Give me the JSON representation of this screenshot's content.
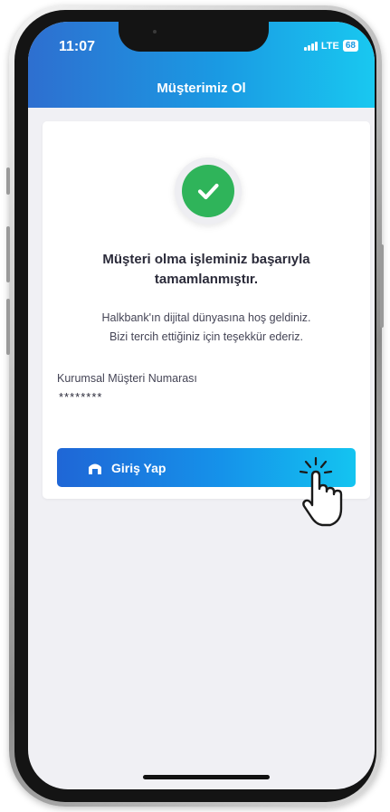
{
  "status_bar": {
    "time": "11:07",
    "network": "LTE",
    "battery": "68"
  },
  "header": {
    "title": "Müşterimiz Ol"
  },
  "success": {
    "title_line1": "Müşteri olma işleminiz başarıyla",
    "title_line2": "tamamlanmıştır.",
    "message_line1": "Halkbank'ın dijital dünyasına hoş geldiniz.",
    "message_line2": "Bizi tercih ettiğiniz için teşekkür ederiz."
  },
  "customer_number": {
    "label": "Kurumsal Müşteri Numarası",
    "value": "********"
  },
  "login_button": {
    "label": "Giriş Yap",
    "icon": "bank-icon"
  },
  "colors": {
    "header_gradient_start": "#2e6fd0",
    "header_gradient_end": "#19c8f0",
    "success_green": "#2fb45a",
    "button_gradient_start": "#1f66d6",
    "button_gradient_end": "#14c4f0"
  }
}
